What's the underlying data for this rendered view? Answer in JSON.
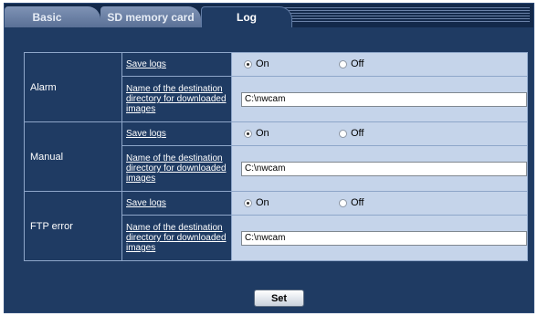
{
  "tabs": [
    {
      "label": "Basic"
    },
    {
      "label": "SD memory card"
    },
    {
      "label": "Log"
    }
  ],
  "groups": [
    {
      "name": "Alarm",
      "save_logs_label": "Save logs",
      "on_label": "On",
      "off_label": "Off",
      "selected": "On",
      "dir_label": "Name of the destination directory for downloaded images",
      "dir_value": "C:\\nwcam"
    },
    {
      "name": "Manual",
      "save_logs_label": "Save logs",
      "on_label": "On",
      "off_label": "Off",
      "selected": "On",
      "dir_label": "Name of the destination directory for downloaded images",
      "dir_value": "C:\\nwcam"
    },
    {
      "name": "FTP error",
      "save_logs_label": "Save logs",
      "on_label": "On",
      "off_label": "Off",
      "selected": "On",
      "dir_label": "Name of the destination directory for downloaded images",
      "dir_value": "C:\\nwcam"
    }
  ],
  "set_button": "Set"
}
